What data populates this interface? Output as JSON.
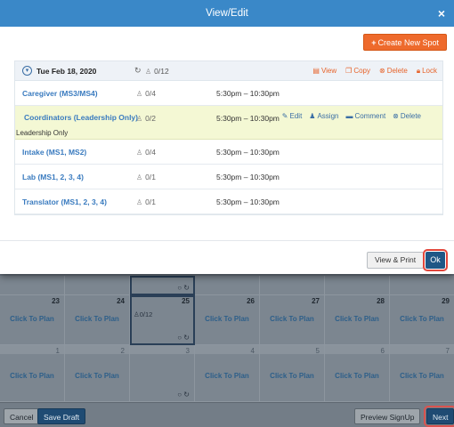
{
  "modal": {
    "title": "View/Edit",
    "close_icon": "×",
    "create_button": "Create New Spot",
    "day": {
      "date": "Tue Feb 18, 2020",
      "count": "0/12",
      "actions": [
        "View",
        "Copy",
        "Delete",
        "Lock"
      ]
    },
    "roles": [
      {
        "name": "Caregiver (MS3/MS4)",
        "count": "0/4",
        "time": "5:30pm – 10:30pm"
      },
      {
        "name": "Coordinators (Leadership Only)",
        "count": "0/2",
        "time": "5:30pm – 10:30pm",
        "note": "Leadership Only",
        "actions": [
          "Edit",
          "Assign",
          "Comment",
          "Delete"
        ]
      },
      {
        "name": "Intake (MS1, MS2)",
        "count": "0/4",
        "time": "5:30pm – 10:30pm"
      },
      {
        "name": "Lab (MS1, 2, 3, 4)",
        "count": "0/1",
        "time": "5:30pm – 10:30pm"
      },
      {
        "name": "Translator (MS1, 2, 3, 4)",
        "count": "0/1",
        "time": "5:30pm – 10:30pm"
      }
    ],
    "footer": {
      "view_print": "View & Print",
      "ok": "Ok"
    }
  },
  "calendar": {
    "row2_days": [
      "23",
      "24",
      "25",
      "26",
      "27",
      "28",
      "29"
    ],
    "row3_days": [
      "1",
      "2",
      "3",
      "4",
      "5",
      "6",
      "7"
    ],
    "click_to_plan": "Click To Plan",
    "cell_count": "0/12"
  },
  "footer": {
    "cancel": "Cancel",
    "save_draft": "Save Draft",
    "preview": "Preview SignUp",
    "next": "Next"
  },
  "colors": {
    "header": "#3a88c8",
    "accent_orange": "#ee6a2c",
    "link_blue": "#3a7bbf",
    "highlight_row": "#f4f8d4",
    "primary_button": "#1f5786"
  }
}
